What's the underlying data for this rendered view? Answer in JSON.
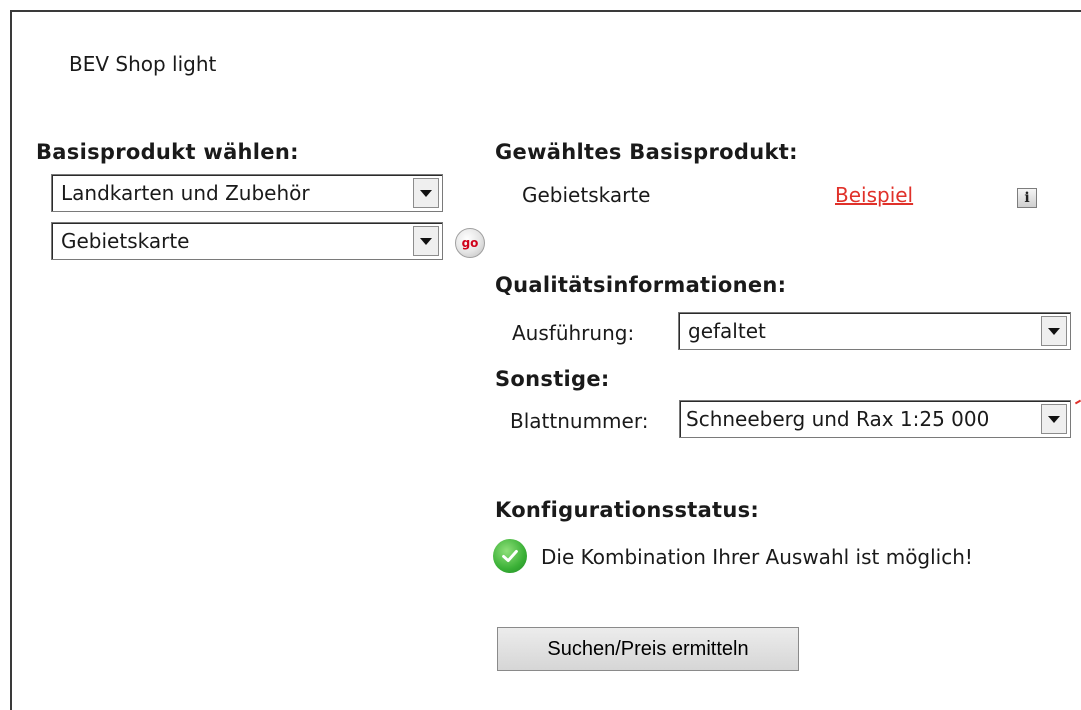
{
  "app": {
    "title": "BEV Shop light"
  },
  "left": {
    "heading": "Basisprodukt wählen:",
    "category_select": {
      "value": "Landkarten und Zubehör"
    },
    "product_select": {
      "value": "Gebietskarte"
    },
    "go_label": "go"
  },
  "right": {
    "selected_heading": "Gewähltes Basisprodukt:",
    "selected_product": "Gebietskarte",
    "example_link": "Beispiel",
    "info_icon_glyph": "i",
    "quality_heading": "Qualitätsinformationen:",
    "ausfuehrung_label": "Ausführung:",
    "ausfuehrung_value": "gefaltet",
    "sonstige_heading": "Sonstige:",
    "blattnummer_label": "Blattnummer:",
    "blattnummer_value": "Schneeberg und Rax 1:25 000",
    "status_heading": "Konfigurationsstatus:",
    "status_message": "Die Kombination Ihrer Auswahl ist möglich!",
    "search_button": "Suchen/Preis ermitteln"
  },
  "colors": {
    "link": "#e0312a",
    "go": "#d0021b",
    "check": "#3ab036"
  }
}
